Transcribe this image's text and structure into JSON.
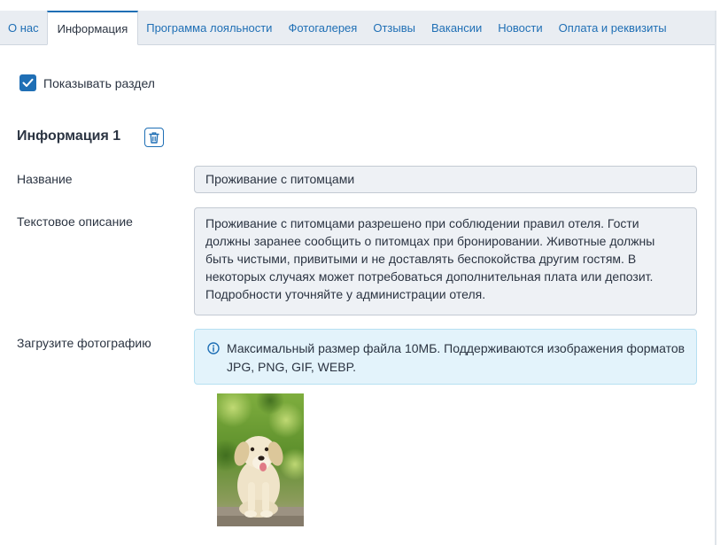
{
  "tabs": [
    {
      "label": "О нас",
      "active": false
    },
    {
      "label": "Информация",
      "active": true
    },
    {
      "label": "Программа лояльности",
      "active": false
    },
    {
      "label": "Фотогалерея",
      "active": false
    },
    {
      "label": "Отзывы",
      "active": false
    },
    {
      "label": "Вакансии",
      "active": false
    },
    {
      "label": "Новости",
      "active": false
    },
    {
      "label": "Оплата и реквизиты",
      "active": false
    }
  ],
  "show_section": {
    "label": "Показывать раздел",
    "checked": true
  },
  "section": {
    "title": "Информация 1",
    "name_label": "Название",
    "name_value": "Проживание с питомцами",
    "description_label": "Текстовое описание",
    "description_value": "Проживание с питомцами разрешено при соблюдении правил отеля. Гости должны заранее сообщить о питомцах при бронировании. Животные должны быть чистыми, привитыми и не доставлять беспокойства другим гостям. В некоторых случаях может потребоваться дополнительная плата или депозит. Подробности уточняйте у администрации отеля.",
    "photo_label": "Загрузите фотографию",
    "photo_info": "Максимальный размер файла 10МБ. Поддерживаются изображения форматов JPG, PNG, GIF, WEBP."
  },
  "colors": {
    "accent": "#1f6fb5",
    "info_bg": "#e3f3fb",
    "field_bg": "#eef1f5"
  },
  "icons": {
    "checkbox": "check-icon",
    "delete": "trash-icon",
    "info": "info-circle-icon"
  }
}
